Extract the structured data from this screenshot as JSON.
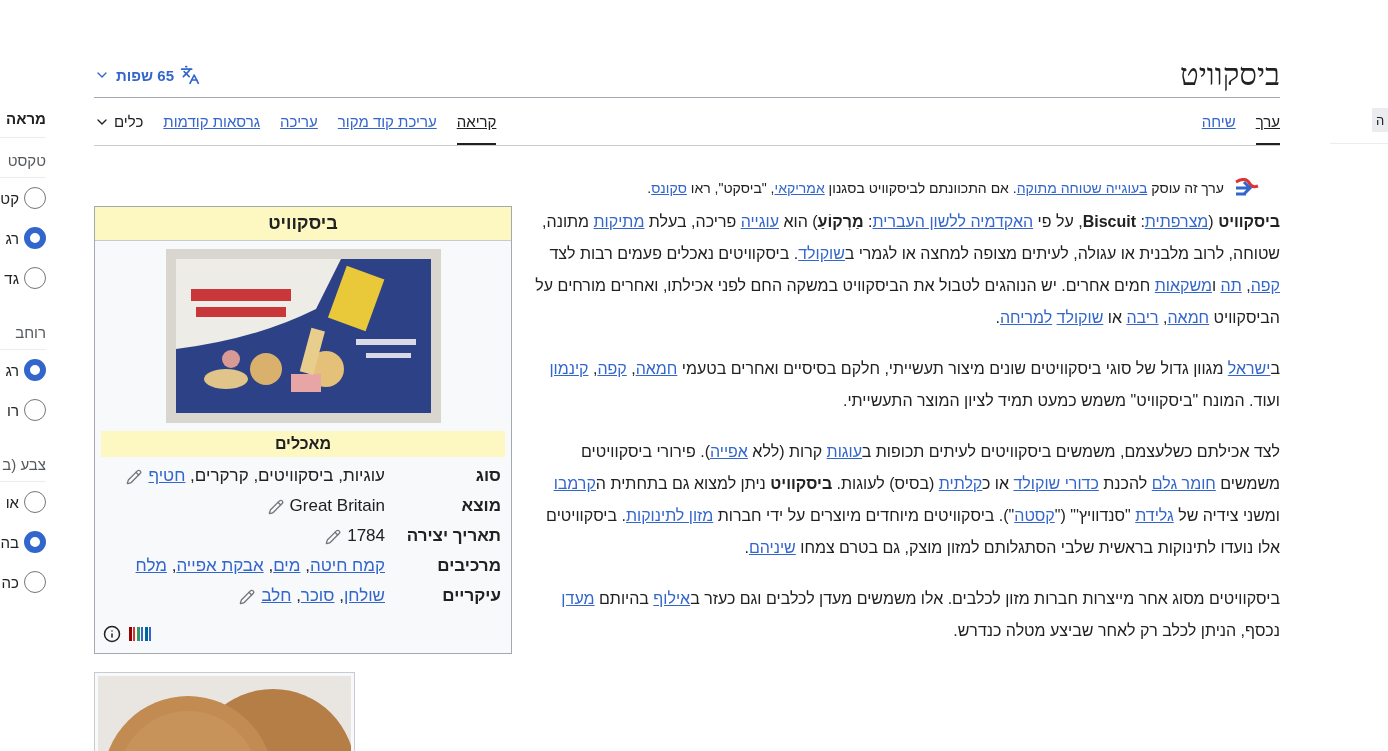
{
  "sidebar": {
    "title": "מראה",
    "sections": [
      {
        "label": "טקסט",
        "options": [
          {
            "label": "קט",
            "selected": false
          },
          {
            "label": "רג",
            "selected": true
          },
          {
            "label": "גד",
            "selected": false
          }
        ]
      },
      {
        "label": "רוחב",
        "options": [
          {
            "label": "רג",
            "selected": true
          },
          {
            "label": "רו",
            "selected": false
          }
        ]
      },
      {
        "label": "צבע (ב",
        "options": [
          {
            "label": "או",
            "selected": false
          },
          {
            "label": "בה",
            "selected": true
          },
          {
            "label": "כה",
            "selected": false
          }
        ]
      }
    ]
  },
  "header": {
    "title": "ביסקוויט",
    "languages": "65 שפות"
  },
  "namespace_tabs": [
    {
      "label": "ערך",
      "selected": true
    },
    {
      "label": "שיחה",
      "selected": false
    }
  ],
  "view_tabs": [
    {
      "label": "קריאה",
      "selected": true
    },
    {
      "label": "עריכת קוד מקור",
      "selected": false
    },
    {
      "label": "עריכה",
      "selected": false
    },
    {
      "label": "גרסאות קודמות",
      "selected": false
    }
  ],
  "tools_menu": "כלים",
  "hatnote": [
    {
      "kind": "text",
      "text": "ערך זה עוסק "
    },
    {
      "kind": "link",
      "text": "בעוגייה שטוחה מתוקה"
    },
    {
      "kind": "text",
      "text": ". אם התכוונתם לביסקוויט בסגנון "
    },
    {
      "kind": "link",
      "text": "אמריקאי"
    },
    {
      "kind": "text",
      "text": ", \"ביסקט\", ראו "
    },
    {
      "kind": "link",
      "text": "סקונס"
    },
    {
      "kind": "text",
      "text": "."
    }
  ],
  "infobox": {
    "title": "ביסקוויט",
    "subheader": "מאכלים",
    "rows": [
      {
        "label": "סוג",
        "editable": true,
        "value": [
          {
            "kind": "text",
            "text": "עוגיות, ביסקוויטים, קרקרים, "
          },
          {
            "kind": "link",
            "text": "חטיף"
          }
        ]
      },
      {
        "label": "מוצא",
        "editable": true,
        "value": [
          {
            "kind": "text",
            "text": "Great Britain"
          }
        ]
      },
      {
        "label": "תאריך יצירה",
        "editable": true,
        "value": [
          {
            "kind": "text",
            "text": "1784"
          }
        ]
      },
      {
        "label": "מרכיבים עיקריים",
        "editable": true,
        "value": [
          {
            "kind": "link",
            "text": "קמח חיטה"
          },
          {
            "kind": "text",
            "text": ", "
          },
          {
            "kind": "link",
            "text": "מים"
          },
          {
            "kind": "text",
            "text": ", "
          },
          {
            "kind": "link",
            "text": "אבקת אפייה"
          },
          {
            "kind": "text",
            "text": ", "
          },
          {
            "kind": "link",
            "text": "מלח"
          },
          {
            "kind": "link",
            "text": "שולחן"
          },
          {
            "kind": "text",
            "text": ", "
          },
          {
            "kind": "link",
            "text": "סוכר"
          },
          {
            "kind": "text",
            "text": ", "
          },
          {
            "kind": "link",
            "text": "חלב"
          }
        ]
      }
    ]
  },
  "paragraphs": [
    [
      {
        "kind": "bold",
        "text": "ביסקוויט"
      },
      {
        "kind": "text",
        "text": " ("
      },
      {
        "kind": "link",
        "text": "מצרפתית"
      },
      {
        "kind": "text",
        "text": ": "
      },
      {
        "kind": "bold",
        "text": "Biscuit"
      },
      {
        "kind": "text",
        "text": ", על פי "
      },
      {
        "kind": "link",
        "text": "האקדמיה ללשון העברית"
      },
      {
        "kind": "text",
        "text": ": "
      },
      {
        "kind": "bold",
        "text": "מַרְקוֹעַ"
      },
      {
        "kind": "text",
        "text": ") הוא "
      },
      {
        "kind": "link",
        "text": "עוגייה"
      },
      {
        "kind": "text",
        "text": " פריכה, בעלת "
      },
      {
        "kind": "link",
        "text": "מתיקות"
      },
      {
        "kind": "text",
        "text": " מתונה, שטוחה, לרוב מלבנית או עגולה, לעיתים מצופה למחצה או לגמרי ב"
      },
      {
        "kind": "link",
        "text": "שוקולד"
      },
      {
        "kind": "text",
        "text": ". ביסקוויטים נאכלים פעמים רבות לצד "
      },
      {
        "kind": "link",
        "text": "קפה"
      },
      {
        "kind": "text",
        "text": ", "
      },
      {
        "kind": "link",
        "text": "תה"
      },
      {
        "kind": "text",
        "text": " ו"
      },
      {
        "kind": "link",
        "text": "משקאות"
      },
      {
        "kind": "text",
        "text": " חמים אחרים. יש הנוהגים לטבול את הביסקוויט במשקה החם לפני אכילתו, ואחרים מורחים על הביסקוויט "
      },
      {
        "kind": "link",
        "text": "חמאה"
      },
      {
        "kind": "text",
        "text": ", "
      },
      {
        "kind": "link",
        "text": "ריבה"
      },
      {
        "kind": "text",
        "text": " או "
      },
      {
        "kind": "link",
        "text": "שוקולד"
      },
      {
        "kind": "link",
        "text": "למריחה"
      },
      {
        "kind": "text",
        "text": "."
      }
    ],
    [
      {
        "kind": "text",
        "text": "ב"
      },
      {
        "kind": "link",
        "text": "ישראל"
      },
      {
        "kind": "text",
        "text": " מגוון גדול של סוגי ביסקוויטים שונים מיצור תעשייתי, חלקם בסיסיים ואחרים בטעמי "
      },
      {
        "kind": "link",
        "text": "חמאה"
      },
      {
        "kind": "text",
        "text": ", "
      },
      {
        "kind": "link",
        "text": "קפה"
      },
      {
        "kind": "text",
        "text": ", "
      },
      {
        "kind": "link",
        "text": "קינמון"
      },
      {
        "kind": "text",
        "text": " ועוד. המונח \"ביסקוויט\" משמש כמעט תמיד לציון המוצר התעשייתי."
      }
    ],
    [
      {
        "kind": "text",
        "text": "לצד אכילתם כשלעצמם, משמשים ביסקוויטים לעיתים תכופות ב"
      },
      {
        "kind": "link",
        "text": "עוגות"
      },
      {
        "kind": "text",
        "text": " קרות (ללא "
      },
      {
        "kind": "link",
        "text": "אפייה"
      },
      {
        "kind": "text",
        "text": "). פירורי ביסקוויטים משמשים "
      },
      {
        "kind": "link",
        "text": "חומר גלם"
      },
      {
        "kind": "text",
        "text": " להכנת "
      },
      {
        "kind": "link",
        "text": "כדורי שוקולד"
      },
      {
        "kind": "text",
        "text": " או כ"
      },
      {
        "kind": "link",
        "text": "קלתית"
      },
      {
        "kind": "text",
        "text": " (בסיס) לעוגות. "
      },
      {
        "kind": "bold",
        "text": "ביסקוויט"
      },
      {
        "kind": "text",
        "text": " ניתן למצוא גם בתחתית ה"
      },
      {
        "kind": "link",
        "text": "קרמבו"
      },
      {
        "kind": "text",
        "text": " ומשני צידיה של "
      },
      {
        "kind": "link",
        "text": "גלידת"
      },
      {
        "kind": "text",
        "text": " \"סנדוויץ'\" (\""
      },
      {
        "kind": "link",
        "text": "קסטה"
      },
      {
        "kind": "text",
        "text": "\"). ביסקוויטים מיוחדים מיוצרים על ידי חברות "
      },
      {
        "kind": "link",
        "text": "מזון לתינוקות"
      },
      {
        "kind": "text",
        "text": ". ביסקוויטים אלו נועדו לתינוקות בראשית שלבי הסתגלותם למזון מוצק, גם בטרם צמחו "
      },
      {
        "kind": "link",
        "text": "שיניהם"
      },
      {
        "kind": "text",
        "text": "."
      }
    ],
    [
      {
        "kind": "text",
        "text": "ביסקוויטים מסוג אחר מייצרות חברות מזון לכלבים. אלו משמשים מעדן לכלבים וגם כעזר ב"
      },
      {
        "kind": "link",
        "text": "אילוף"
      },
      {
        "kind": "text",
        "text": " בהיותם "
      },
      {
        "kind": "link",
        "text": "מעדן"
      },
      {
        "kind": "text",
        "text": " נכסף, הניתן לכלב רק לאחר שביצע מטלה כנדרש."
      }
    ]
  ],
  "side_tab": "ה"
}
